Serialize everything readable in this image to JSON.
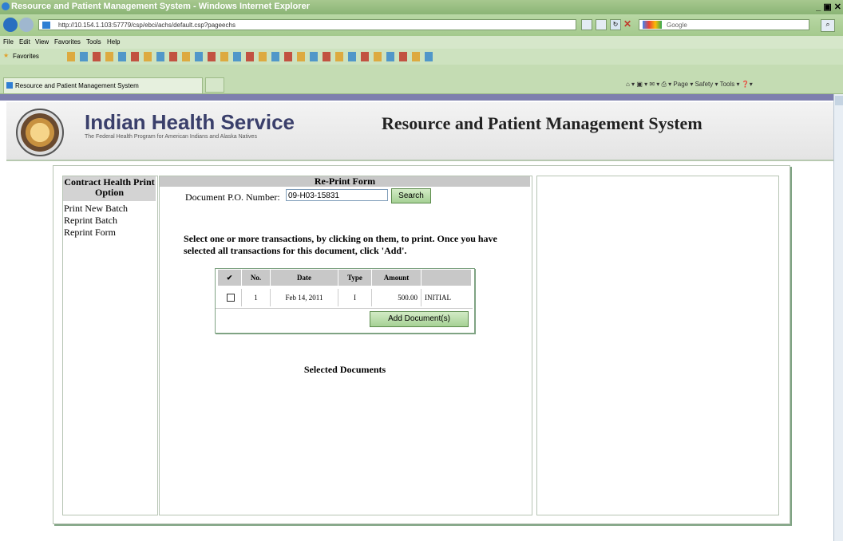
{
  "browser": {
    "title": "Resource and Patient Management System - Windows Internet Explorer",
    "url": "http://10.154.1.103:57779/csp/ebci/achs/default.csp?pageechs",
    "search_placeholder": "Google",
    "menu": [
      "File",
      "Edit",
      "View",
      "Favorites",
      "Tools",
      "Help"
    ],
    "favorites_label": "Favorites",
    "tab_label": "Resource and Patient Management System",
    "commands": [
      "Page",
      "Safety",
      "Tools"
    ]
  },
  "header": {
    "org_name": "Indian Health Service",
    "org_subtitle": "The Federal Health Program for American Indians and Alaska Natives",
    "system_name": "Resource and Patient Management System"
  },
  "sidebar": {
    "title": "Contract Health Print Option",
    "links": [
      "Print New Batch",
      "Reprint Batch",
      "Reprint Form"
    ]
  },
  "form": {
    "title": "Re-Print Form",
    "po_label": "Document P.O. Number:",
    "po_value": "09-H03-15831",
    "search_label": "Search",
    "instructions": "Select one or more transactions, by clicking on them, to print. Once you have selected all transactions for this document, click 'Add'.",
    "table": {
      "headers": [
        "✔",
        "No.",
        "Date",
        "Type",
        "Amount",
        ""
      ],
      "rows": [
        {
          "checked": false,
          "no": "1",
          "date": "Feb 14, 2011",
          "type": "I",
          "amount": "500.00",
          "desc": "INITIAL"
        }
      ]
    },
    "add_label": "Add Document(s)",
    "selected_heading": "Selected Documents"
  }
}
